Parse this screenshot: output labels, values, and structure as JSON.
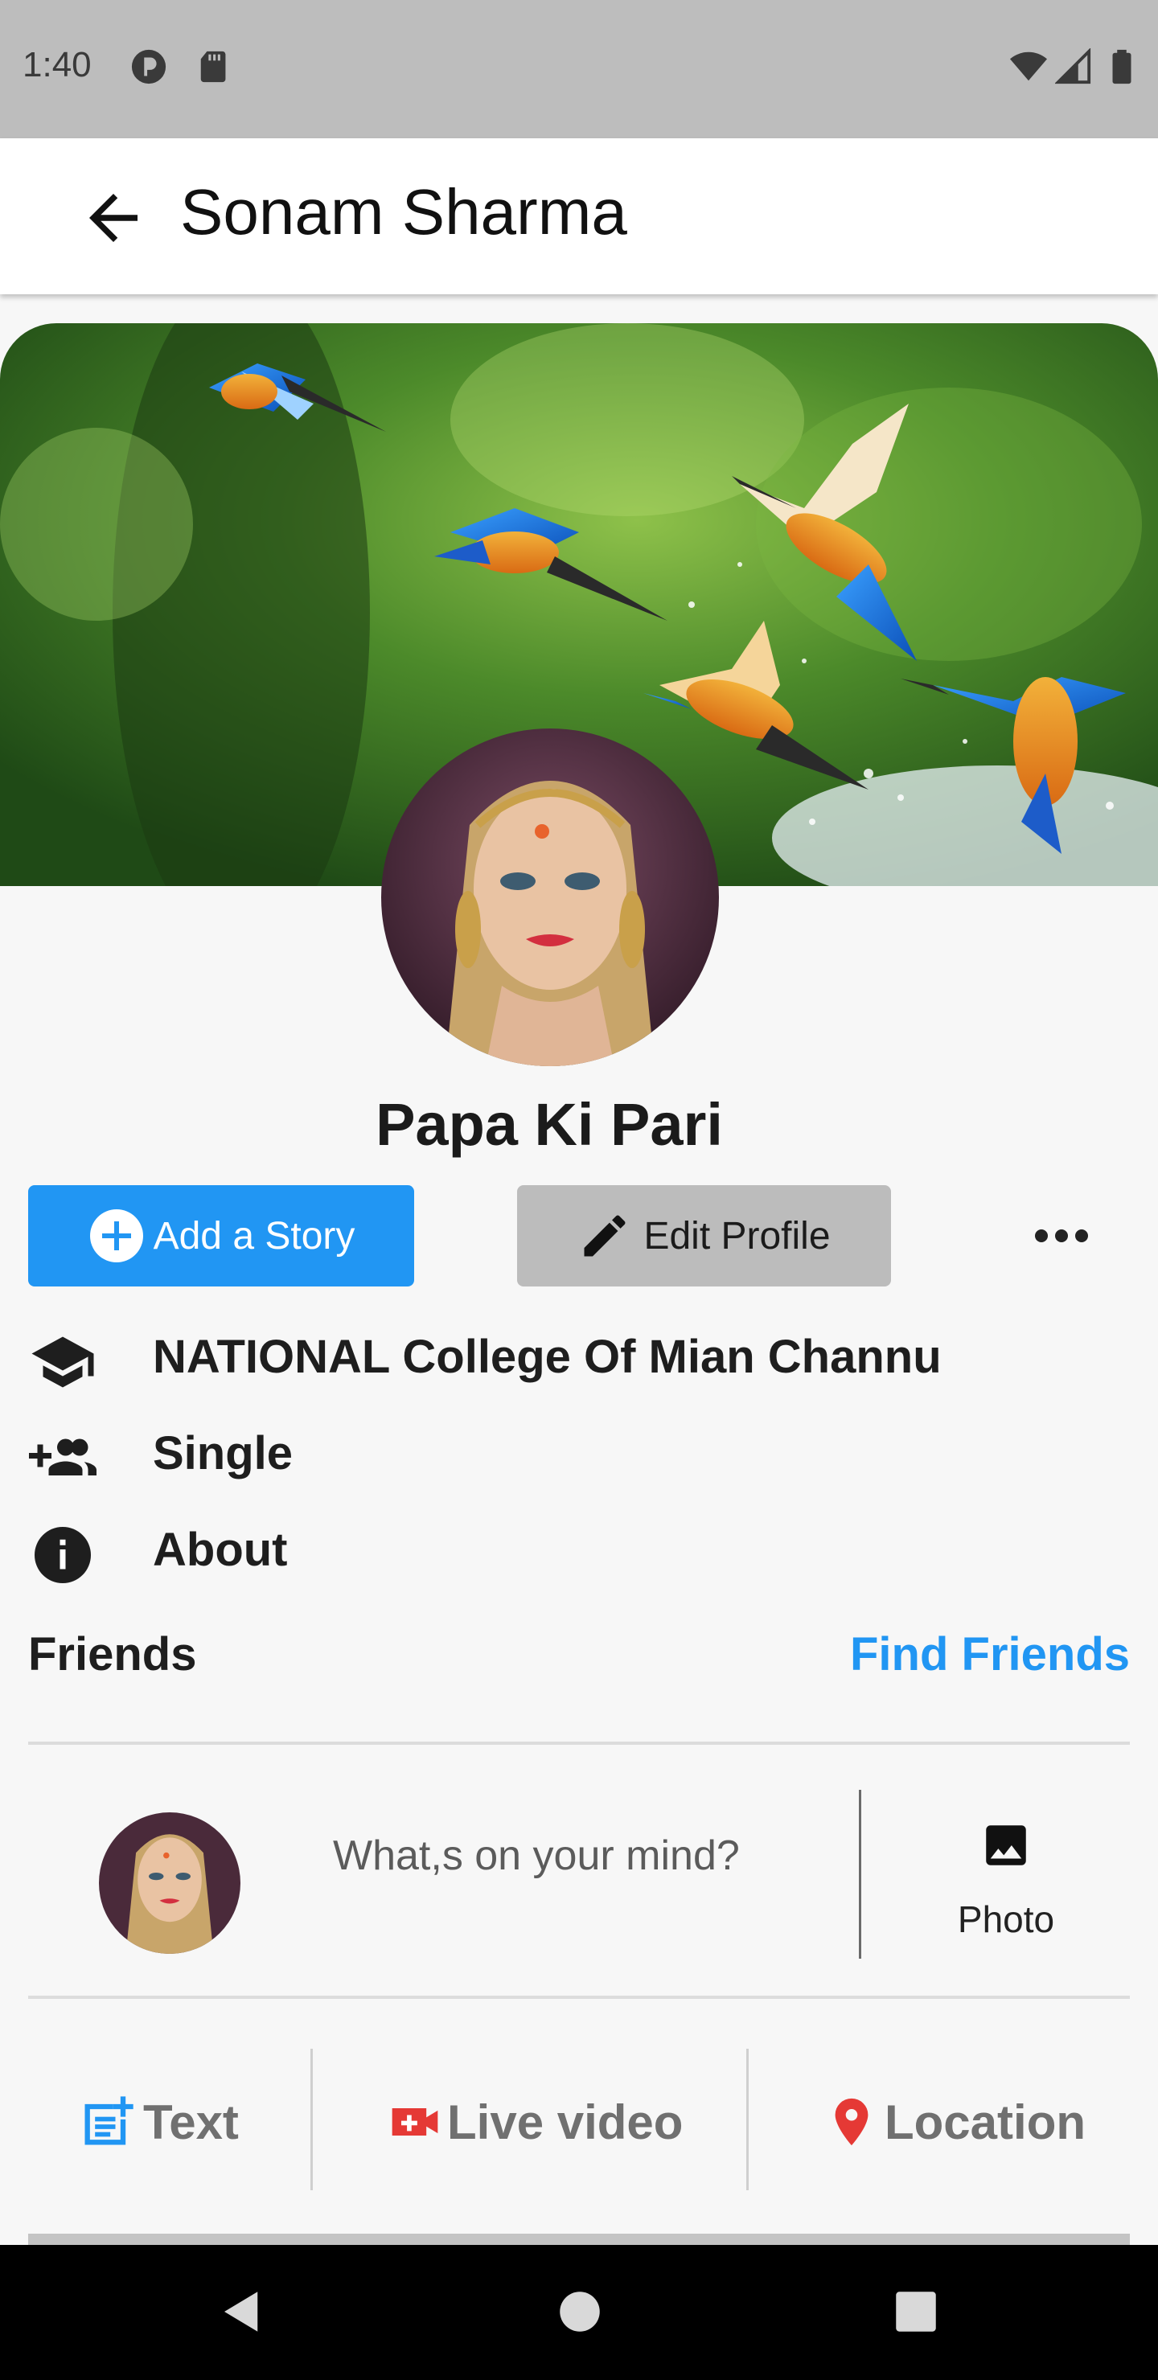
{
  "status_bar": {
    "time": "1:40"
  },
  "app_bar": {
    "title": "Sonam Sharma"
  },
  "profile": {
    "name": "Papa Ki Pari"
  },
  "buttons": {
    "add_story": "Add a Story",
    "edit_profile": "Edit Profile"
  },
  "info": {
    "education": "NATIONAL College Of Mian Channu",
    "relationship": "Single",
    "about": "About"
  },
  "friends": {
    "label": "Friends",
    "find": "Find Friends"
  },
  "composer": {
    "placeholder": "What,s on your mind?",
    "photo_label": "Photo"
  },
  "actions": {
    "text": "Text",
    "live_video": "Live video",
    "location": "Location"
  },
  "colors": {
    "accent": "#2196f3",
    "live_red": "#e53935"
  }
}
